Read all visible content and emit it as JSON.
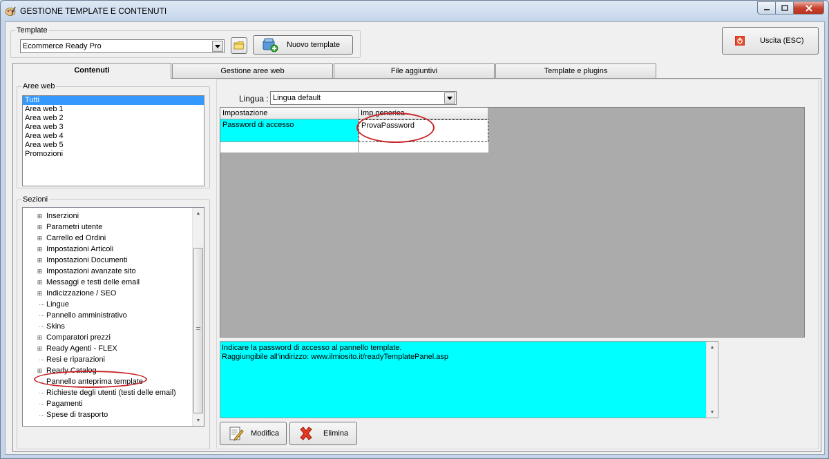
{
  "window": {
    "title": "GESTIONE TEMPLATE E CONTENUTI"
  },
  "template": {
    "group_label": "Template",
    "selected": "Ecommerce Ready Pro",
    "new_template_label": "Nuovo template",
    "exit_label": "Uscita (ESC)"
  },
  "tabs": [
    {
      "label": "Contenuti"
    },
    {
      "label": "Gestione aree web"
    },
    {
      "label": "File aggiuntivi"
    },
    {
      "label": "Template e plugins"
    }
  ],
  "aree_web": {
    "label": "Aree web",
    "items": [
      "Tutti",
      "Area web 1",
      "Area web 2",
      "Area web 3",
      "Area web 4",
      "Area web 5",
      "Promozioni"
    ]
  },
  "sezioni": {
    "label": "Sezioni",
    "items": [
      {
        "label": "Inserzioni",
        "expandable": true
      },
      {
        "label": "Parametri utente",
        "expandable": true
      },
      {
        "label": "Carrello ed Ordini",
        "expandable": true
      },
      {
        "label": "Impostazioni Articoli",
        "expandable": true
      },
      {
        "label": "Impostazioni Documenti",
        "expandable": true
      },
      {
        "label": "Impostazioni avanzate sito",
        "expandable": true
      },
      {
        "label": "Messaggi e testi delle email",
        "expandable": true
      },
      {
        "label": "Indicizzazione / SEO",
        "expandable": true
      },
      {
        "label": "Lingue",
        "expandable": false
      },
      {
        "label": "Pannello amministrativo",
        "expandable": false
      },
      {
        "label": "Skins",
        "expandable": false
      },
      {
        "label": "Comparatori prezzi",
        "expandable": true
      },
      {
        "label": "Ready Agenti - FLEX",
        "expandable": true
      },
      {
        "label": "Resi e riparazioni",
        "expandable": false
      },
      {
        "label": "Ready Catalog",
        "expandable": true
      },
      {
        "label": "Pannello anteprima template",
        "expandable": false
      },
      {
        "label": "Richieste degli utenti (testi delle email)",
        "expandable": false
      },
      {
        "label": "Pagamenti",
        "expandable": false
      },
      {
        "label": "Spese di trasporto",
        "expandable": false
      }
    ]
  },
  "lingua": {
    "label": "Lingua :",
    "selected": "Lingua default"
  },
  "settings_grid": {
    "col_setting": "Impostazione",
    "col_value": "Imp.generica",
    "rows": [
      {
        "setting": "Password di accesso",
        "value": "ProvaPassword"
      }
    ]
  },
  "description": {
    "line1": "Indicare la password di accesso al pannello template.",
    "line2": "Raggiungibile all'indirizzo: www.ilmiosito.it/readyTemplatePanel.asp"
  },
  "actions": {
    "edit_label": "Modifica",
    "delete_label": "Elimina"
  },
  "colors": {
    "highlight_cyan": "#00ffff",
    "selection_blue": "#3399ff",
    "annotation_red": "#c8262a"
  }
}
